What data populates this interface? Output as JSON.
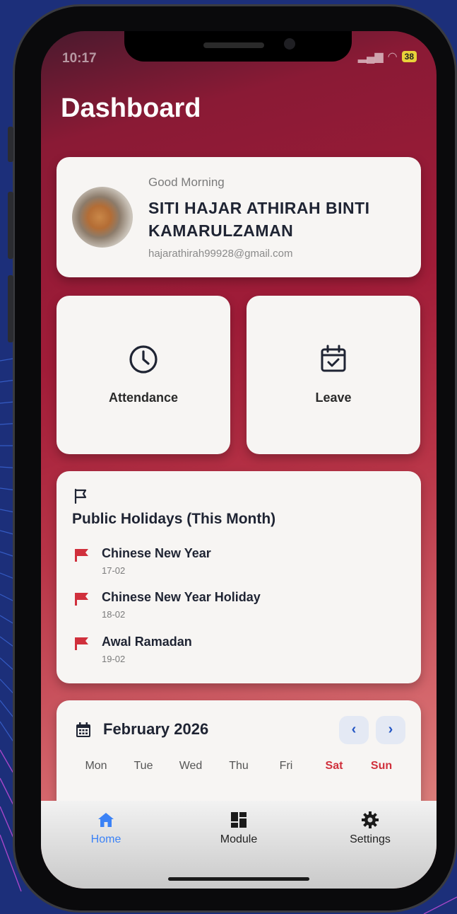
{
  "status": {
    "time": "10:17",
    "battery": "38"
  },
  "page": {
    "title": "Dashboard"
  },
  "profile": {
    "greeting": "Good Morning",
    "name": "SITI HAJAR ATHIRAH BINTI KAMARULZAMAN",
    "email": "hajarathirah99928@gmail.com"
  },
  "tiles": {
    "attendance_label": "Attendance",
    "leave_label": "Leave"
  },
  "holidays": {
    "title": "Public Holidays (This Month)",
    "items": [
      {
        "name": "Chinese New Year",
        "date": "17-02"
      },
      {
        "name": "Chinese New Year Holiday",
        "date": "18-02"
      },
      {
        "name": "Awal Ramadan",
        "date": "19-02"
      }
    ]
  },
  "calendar": {
    "title": "February 2026",
    "prev": "‹",
    "next": "›",
    "weekdays": [
      "Mon",
      "Tue",
      "Wed",
      "Thu",
      "Fri",
      "Sat",
      "Sun"
    ]
  },
  "nav": {
    "items": [
      {
        "label": "Home",
        "icon": "home-icon",
        "active": true
      },
      {
        "label": "Module",
        "icon": "grid-icon",
        "active": false
      },
      {
        "label": "Settings",
        "icon": "gear-icon",
        "active": false
      }
    ]
  },
  "colors": {
    "accent_blue": "#3b82f6",
    "flag_red": "#d0303c",
    "weekend_red": "#d0303c"
  }
}
